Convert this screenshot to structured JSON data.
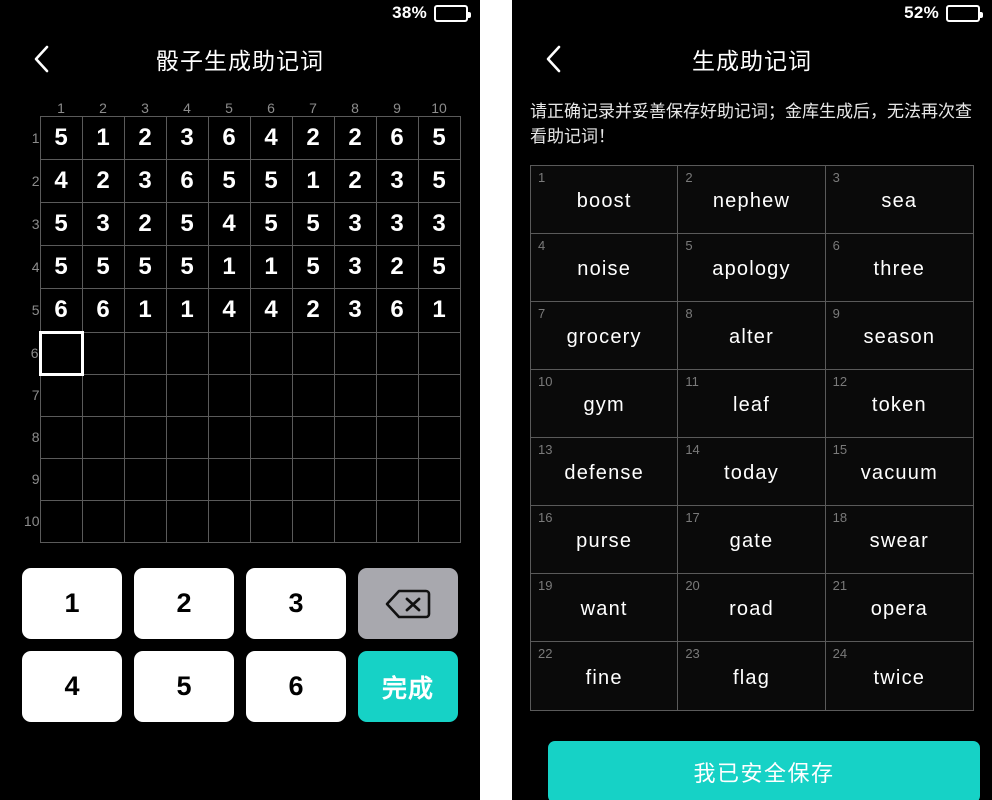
{
  "left_panel": {
    "status": {
      "battery_percent": "38%",
      "battery_level": 38
    },
    "nav": {
      "back_icon": "chevron-left-icon",
      "title": "骰子生成助记词"
    },
    "dice_grid": {
      "columns": [
        "1",
        "2",
        "3",
        "4",
        "5",
        "6",
        "7",
        "8",
        "9",
        "10"
      ],
      "rows": [
        "1",
        "2",
        "3",
        "4",
        "5",
        "6",
        "7",
        "8",
        "9",
        "10"
      ],
      "values": [
        [
          "5",
          "1",
          "2",
          "3",
          "6",
          "4",
          "2",
          "2",
          "6",
          "5"
        ],
        [
          "4",
          "2",
          "3",
          "6",
          "5",
          "5",
          "1",
          "2",
          "3",
          "5"
        ],
        [
          "5",
          "3",
          "2",
          "5",
          "4",
          "5",
          "5",
          "3",
          "3",
          "3"
        ],
        [
          "5",
          "5",
          "5",
          "5",
          "1",
          "1",
          "5",
          "3",
          "2",
          "5"
        ],
        [
          "6",
          "6",
          "1",
          "1",
          "4",
          "4",
          "2",
          "3",
          "6",
          "1"
        ],
        [
          "",
          "",
          "",
          "",
          "",
          "",
          "",
          "",
          "",
          ""
        ],
        [
          "",
          "",
          "",
          "",
          "",
          "",
          "",
          "",
          "",
          ""
        ],
        [
          "",
          "",
          "",
          "",
          "",
          "",
          "",
          "",
          "",
          ""
        ],
        [
          "",
          "",
          "",
          "",
          "",
          "",
          "",
          "",
          "",
          ""
        ],
        [
          "",
          "",
          "",
          "",
          "",
          "",
          "",
          "",
          "",
          ""
        ]
      ],
      "active_cell": {
        "row": 6,
        "col": 1
      }
    },
    "keypad": {
      "keys": [
        "1",
        "2",
        "3"
      ],
      "keys_row2": [
        "4",
        "5",
        "6"
      ],
      "backspace_icon": "backspace-icon",
      "done_label": "完成"
    }
  },
  "right_panel": {
    "status": {
      "battery_percent": "52%",
      "battery_level": 52
    },
    "nav": {
      "back_icon": "chevron-left-icon",
      "title": "生成助记词"
    },
    "notice": "请正确记录并妥善保存好助记词；金库生成后，无法再次查看助记词！",
    "mnemonic": {
      "words": [
        {
          "index": "1",
          "word": "boost"
        },
        {
          "index": "2",
          "word": "nephew"
        },
        {
          "index": "3",
          "word": "sea"
        },
        {
          "index": "4",
          "word": "noise"
        },
        {
          "index": "5",
          "word": "apology"
        },
        {
          "index": "6",
          "word": "three"
        },
        {
          "index": "7",
          "word": "grocery"
        },
        {
          "index": "8",
          "word": "alter"
        },
        {
          "index": "9",
          "word": "season"
        },
        {
          "index": "10",
          "word": "gym"
        },
        {
          "index": "11",
          "word": "leaf"
        },
        {
          "index": "12",
          "word": "token"
        },
        {
          "index": "13",
          "word": "defense"
        },
        {
          "index": "14",
          "word": "today"
        },
        {
          "index": "15",
          "word": "vacuum"
        },
        {
          "index": "16",
          "word": "purse"
        },
        {
          "index": "17",
          "word": "gate"
        },
        {
          "index": "18",
          "word": "swear"
        },
        {
          "index": "19",
          "word": "want"
        },
        {
          "index": "20",
          "word": "road"
        },
        {
          "index": "21",
          "word": "opera"
        },
        {
          "index": "22",
          "word": "fine"
        },
        {
          "index": "23",
          "word": "flag"
        },
        {
          "index": "24",
          "word": "twice"
        }
      ]
    },
    "save_button_label": "我已安全保存"
  },
  "colors": {
    "accent_teal": "#16d2c6",
    "background": "#000000",
    "key_white": "#ffffff",
    "key_gray": "#a8a8ae",
    "grid_line": "#5a5a5a",
    "muted_text": "#8c8c8c"
  }
}
